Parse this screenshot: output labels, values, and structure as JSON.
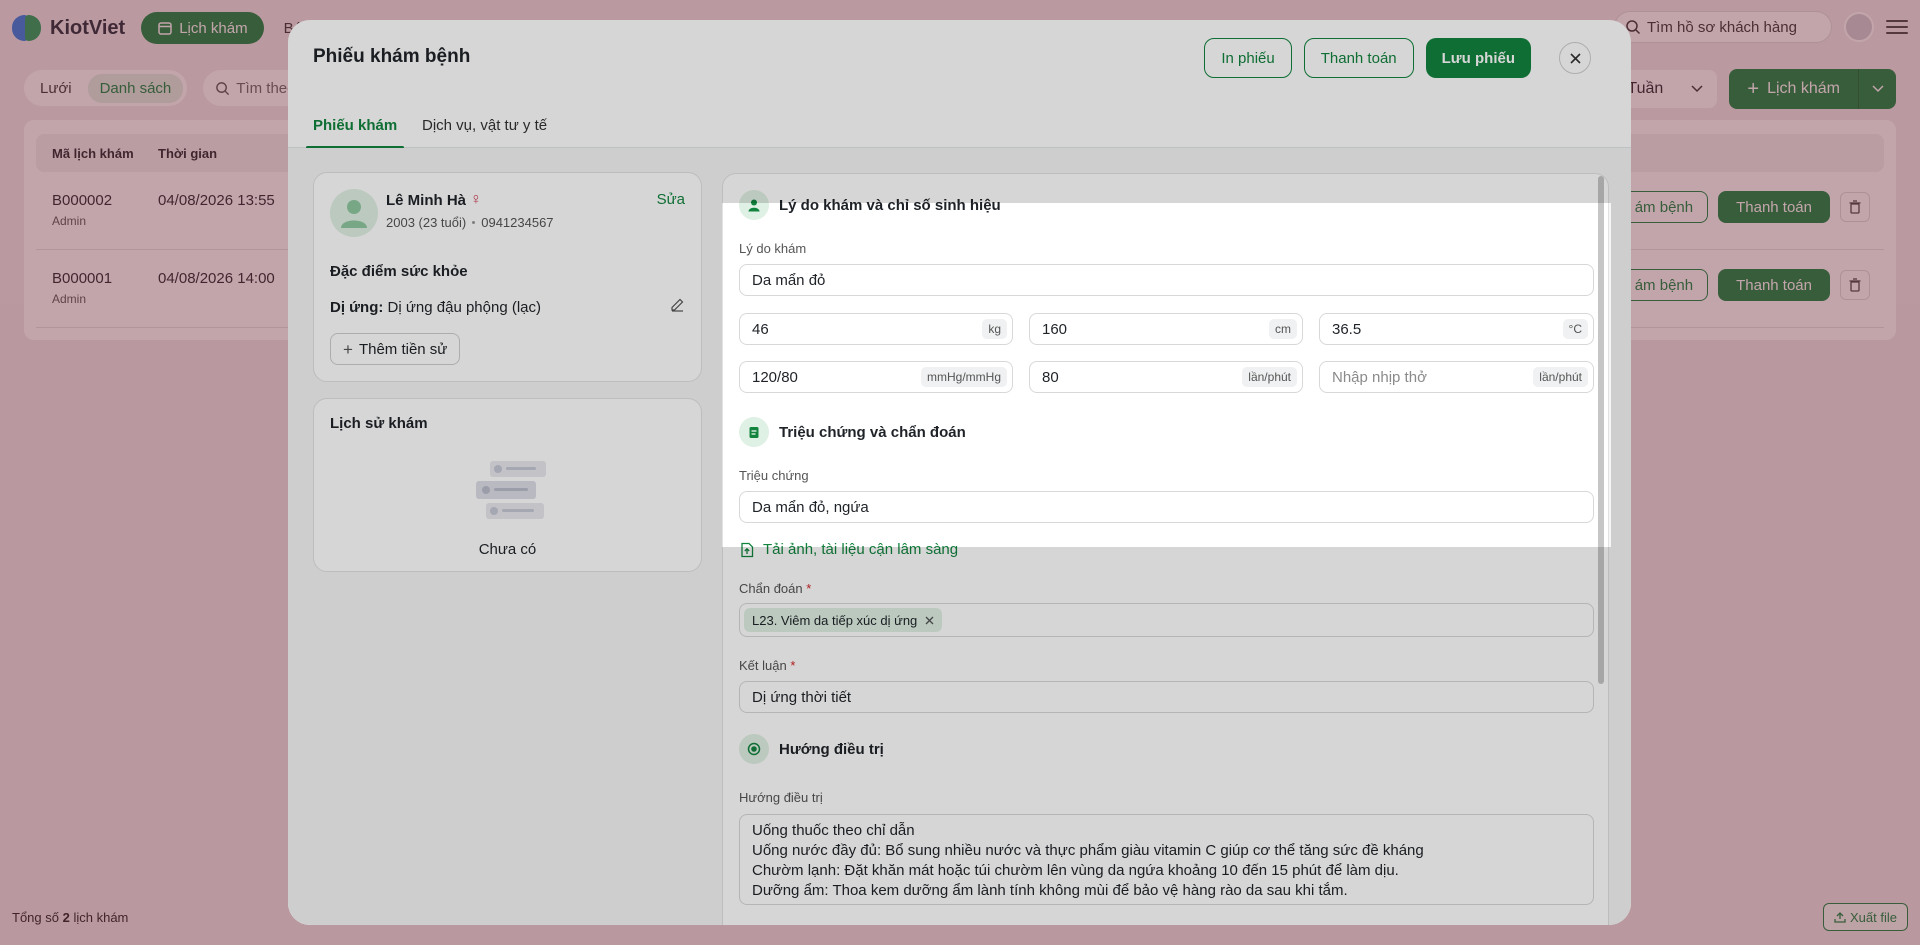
{
  "app": {
    "logo_text": "KiotViet",
    "nav_active": "Lịch khám",
    "nav_next": "Bán",
    "search_placeholder": "Tìm hồ sơ khách hàng",
    "view_modes": [
      "Lưới",
      "Danh sách"
    ],
    "toolbar_search_placeholder": "Tìm theo",
    "week_select": "Tuần",
    "add_appointment": "Lịch khám",
    "table_headers": [
      "Mã lịch khám",
      "Thời gian"
    ],
    "rows": [
      {
        "code": "B000002",
        "by": "Admin",
        "time": "04/08/2026 13:55",
        "action1": "ám bệnh",
        "action2": "Thanh toán"
      },
      {
        "code": "B000001",
        "by": "Admin",
        "time": "04/08/2026 14:00",
        "action1": "ám bệnh",
        "action2": "Thanh toán"
      }
    ],
    "footer_total_prefix": "Tổng số",
    "footer_total_count": "2",
    "footer_total_suffix": "lịch khám",
    "export_label": "Xuất file"
  },
  "modal": {
    "title": "Phiếu khám bệnh",
    "print_label": "In phiếu",
    "pay_label": "Thanh toán",
    "save_label": "Lưu phiếu",
    "tabs": [
      "Phiếu khám",
      "Dịch vụ, vật tư y tế"
    ],
    "patient": {
      "name": "Lê Minh Hà",
      "gender_symbol": "♀",
      "birth": "2003 (23 tuổi)",
      "phone": "0941234567",
      "edit_label": "Sửa"
    },
    "health": {
      "title": "Đặc điểm sức khỏe",
      "allergy_label": "Dị ứng:",
      "allergy_value": "Dị ứng đậu phộng (lạc)",
      "add_history": "Thêm tiền sử"
    },
    "history": {
      "title": "Lịch sử khám",
      "empty": "Chưa có"
    },
    "form": {
      "vitals_section": "Lý do khám và chỉ số sinh hiệu",
      "reason_label": "Lý do khám",
      "reason_value": "Da mẩn đỏ",
      "weight": "46",
      "weight_unit": "kg",
      "height": "160",
      "height_unit": "cm",
      "temp": "36.5",
      "temp_unit": "°C",
      "bp": "120/80",
      "bp_unit": "mmHg/mmHg",
      "pulse": "80",
      "pulse_unit": "lần/phút",
      "resp_placeholder": "Nhập nhịp thở",
      "resp_unit": "lần/phút",
      "symptom_section": "Triệu chứng và chẩn đoán",
      "symptom_label": "Triệu chứng",
      "symptom_value": "Da mẩn đỏ, ngứa",
      "upload_label": "Tải ảnh, tài liệu cận lâm sàng",
      "diagnosis_label": "Chẩn đoán",
      "diagnosis_chip": "L23. Viêm da tiếp xúc dị ứng",
      "conclusion_label": "Kết luận",
      "conclusion_value": "Dị ứng thời tiết",
      "treatment_section": "Hướng điều trị",
      "treatment_label": "Hướng điều trị",
      "treatment_lines": [
        "Uống thuốc theo chỉ dẫn",
        "Uống nước đầy đủ: Bổ sung nhiều nước và thực phẩm giàu vitamin C giúp cơ thể tăng sức đề kháng",
        "Chườm lạnh: Đặt khăn mát hoặc túi chườm lên vùng da ngứa khoảng 10 đến 15 phút để làm dịu.",
        "Dưỡng ẩm: Thoa kem dưỡng ẩm lành tính không mùi để bảo vệ hàng rào da sau khi tắm."
      ],
      "required_mark": "*"
    }
  }
}
